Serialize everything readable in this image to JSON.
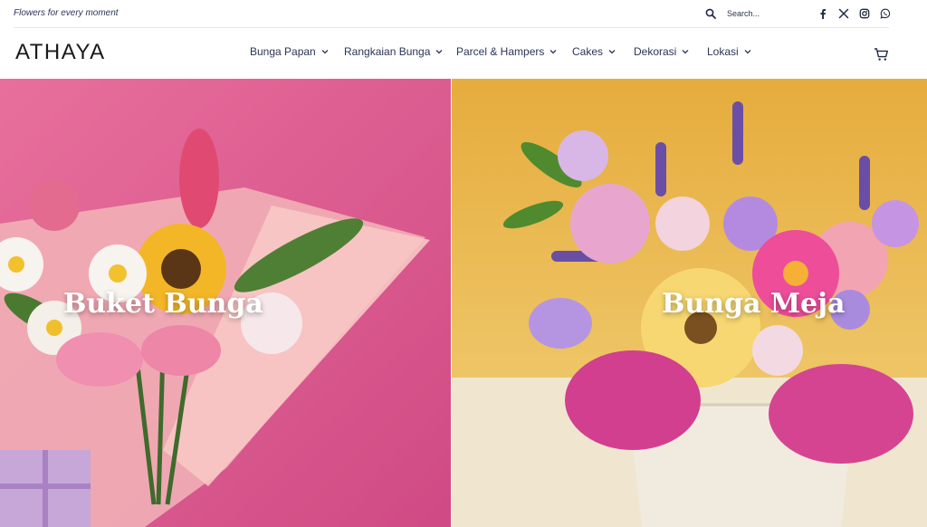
{
  "topbar": {
    "tagline": "Flowers for every moment",
    "search_placeholder": "Search...",
    "social_icons": [
      "facebook-icon",
      "x-icon",
      "instagram-icon",
      "whatsapp-icon"
    ]
  },
  "header": {
    "logo": "ATHAYA",
    "nav": [
      {
        "label": "Bunga Papan"
      },
      {
        "label": "Rangkaian Bunga"
      },
      {
        "label": "Parcel & Hampers"
      },
      {
        "label": "Cakes"
      },
      {
        "label": "Dekorasi"
      },
      {
        "label": "Lokasi"
      }
    ],
    "cart_icon": "cart-icon"
  },
  "hero": [
    {
      "title": "Buket Bunga"
    },
    {
      "title": "Bunga Meja"
    }
  ],
  "colors": {
    "text_dark": "#2b3556",
    "hero_left_bg": "#d9588e",
    "hero_right_bg": "#e9b94a"
  }
}
